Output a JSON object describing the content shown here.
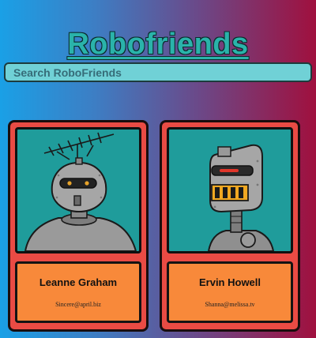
{
  "header": {
    "title": "Robofriends"
  },
  "search": {
    "placeholder": "Search RoboFriends",
    "value": ""
  },
  "colors": {
    "accent": "#2ab3aa",
    "card": "#e94b44",
    "card_info": "#f8893a",
    "image_bg": "#1f9c9b",
    "search_bg": "#70d1d6"
  },
  "cards": [
    {
      "name": "Leanne Graham",
      "email": "Sincere@april.biz",
      "image_icon": "robot-antenna-icon"
    },
    {
      "name": "Ervin Howell",
      "email": "Shanna@melissa.tv",
      "image_icon": "robot-visor-icon"
    }
  ]
}
